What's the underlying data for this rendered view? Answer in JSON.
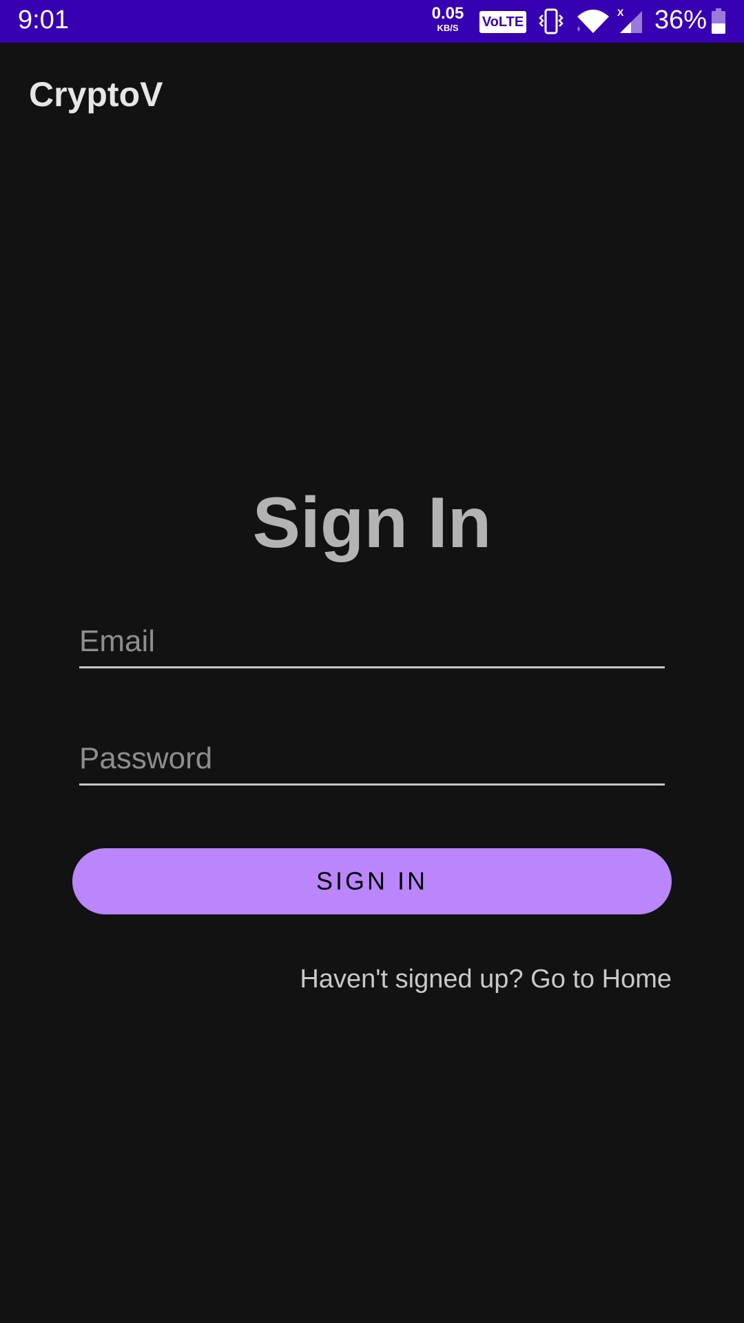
{
  "status_bar": {
    "time": "9:01",
    "net_speed_value": "0.05",
    "net_speed_unit": "KB/S",
    "volte_label": "VoLTE",
    "battery_percent": "36%",
    "icons": [
      "vibrate-icon",
      "wifi-icon",
      "signal-icon",
      "battery-icon"
    ]
  },
  "app_bar": {
    "title": "CryptoV"
  },
  "sign_in": {
    "heading": "Sign In",
    "email_placeholder": "Email",
    "email_value": "",
    "password_placeholder": "Password",
    "password_value": "",
    "button_label": "SIGN IN",
    "home_link": "Haven't signed up? Go to Home"
  },
  "colors": {
    "status_bar_bg": "#3700b3",
    "background": "#121212",
    "accent": "#bb86fc"
  }
}
